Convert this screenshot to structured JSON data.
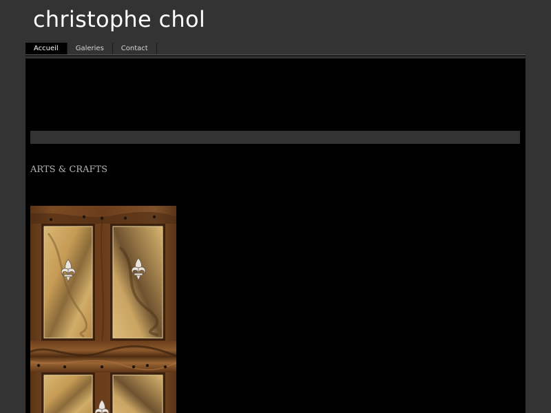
{
  "site": {
    "title": "christophe chol"
  },
  "nav": {
    "items": [
      {
        "label": "Accueil",
        "active": true
      },
      {
        "label": "Galeries",
        "active": false
      },
      {
        "label": "Contact",
        "active": false
      }
    ]
  },
  "main": {
    "heading": "ARTS & CRAFTS",
    "image_subject": "carved wooden door with fleur-de-lis panels"
  },
  "colors": {
    "page_bg": "#333333",
    "content_bg": "#000000",
    "title_text": "#ffffff",
    "heading_text": "#b4b4b4"
  }
}
